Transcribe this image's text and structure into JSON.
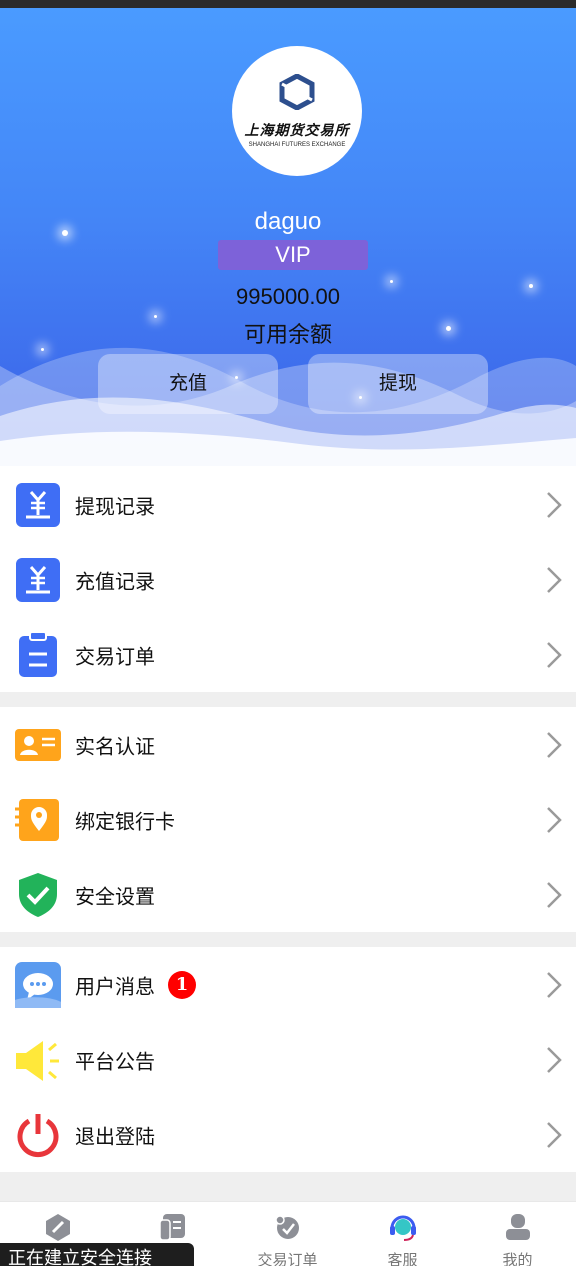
{
  "header": {
    "logo": {
      "cn_text": "上海期货交易所",
      "en_text": "SHANGHAI FUTURES EXCHANGE"
    },
    "username": "daguo",
    "level": "VIP",
    "balance": "995000.00",
    "balance_label": "可用余额",
    "recharge_button": "充值",
    "withdraw_button": "提现"
  },
  "menu_groups": [
    {
      "items": [
        {
          "label": "提现记录",
          "icon": "yuan-doc-icon"
        },
        {
          "label": "充值记录",
          "icon": "yuan-doc-icon"
        },
        {
          "label": "交易订单",
          "icon": "clipboard-icon"
        }
      ]
    },
    {
      "items": [
        {
          "label": "实名认证",
          "icon": "id-card-icon"
        },
        {
          "label": "绑定银行卡",
          "icon": "location-card-icon"
        },
        {
          "label": "安全设置",
          "icon": "shield-check-icon"
        }
      ]
    },
    {
      "items": [
        {
          "label": "用户消息",
          "icon": "chat-bubble-icon",
          "badge": "1"
        },
        {
          "label": "平台公告",
          "icon": "speaker-icon"
        },
        {
          "label": "退出登陆",
          "icon": "power-icon"
        }
      ]
    }
  ],
  "tabbar": {
    "items": [
      {
        "label": "",
        "icon": "compass-icon"
      },
      {
        "label": "",
        "icon": "market-icon"
      },
      {
        "label": "交易订单",
        "icon": "orders-icon"
      },
      {
        "label": "客服",
        "icon": "headset-icon",
        "active": true
      },
      {
        "label": "我的",
        "icon": "user-icon"
      }
    ]
  },
  "toast": "正在建立安全连接",
  "colors": {
    "hero_top": "#4a9bff",
    "hero_bottom": "#3a60e6",
    "vip_badge": "#7d62d9",
    "icon_blue": "#3f6ef5",
    "icon_orange": "#ffa41b",
    "icon_green": "#22b35a",
    "icon_yellow": "#ffe83a",
    "icon_red": "#e8363b",
    "badge_red": "#ff0000"
  }
}
